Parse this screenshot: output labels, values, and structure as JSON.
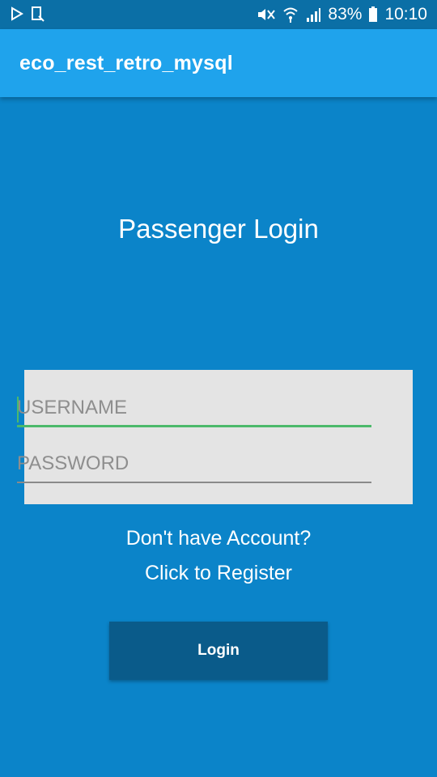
{
  "status_bar": {
    "battery_percent": "83%",
    "time": "10:10",
    "left_icons": [
      "play-store-icon",
      "screenshot-icon"
    ],
    "right_icons": [
      "mute-icon",
      "wifi-icon",
      "signal-icon",
      "battery-icon"
    ]
  },
  "app_bar": {
    "title": "eco_rest_retro_mysql"
  },
  "main": {
    "heading": "Passenger Login",
    "username": {
      "placeholder": "USERNAME",
      "value": ""
    },
    "password": {
      "placeholder": "PASSWORD",
      "value": ""
    },
    "register_line1": "Don't have Account?",
    "register_line2": "Click to Register",
    "login_button": "Login"
  },
  "colors": {
    "background": "#0b84c9",
    "app_bar": "#1fa3ec",
    "status_bar": "#0b6fa6",
    "button": "#0a5b8a",
    "focus_accent": "#4cb96b",
    "form_card": "#e4e4e4"
  }
}
